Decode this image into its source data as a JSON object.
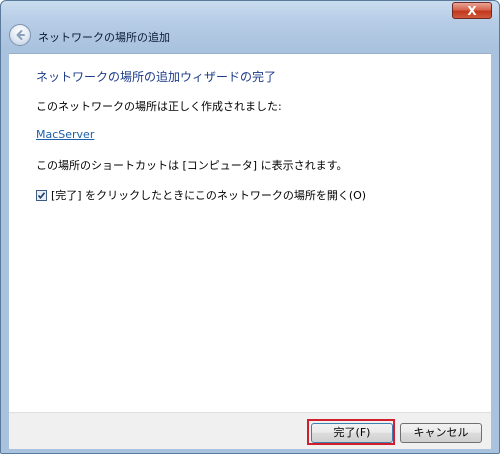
{
  "window": {
    "close_label": "X"
  },
  "header": {
    "title": "ネットワークの場所の追加"
  },
  "content": {
    "heading": "ネットワークの場所の追加ウィザードの完了",
    "created_message": "このネットワークの場所は正しく作成されました:",
    "location_name": "MacServer",
    "shortcut_message": "この場所のショートカットは [コンピュータ] に表示されます。",
    "open_checkbox_label": "[完了] をクリックしたときにこのネットワークの場所を開く(O)",
    "open_checkbox_checked": true
  },
  "footer": {
    "finish_label": "完了(F)",
    "cancel_label": "キャンセル",
    "highlight_color": "#d21d2d"
  },
  "icons": {
    "back": "back-arrow-icon",
    "close": "close-icon",
    "check": "checkmark-icon"
  }
}
